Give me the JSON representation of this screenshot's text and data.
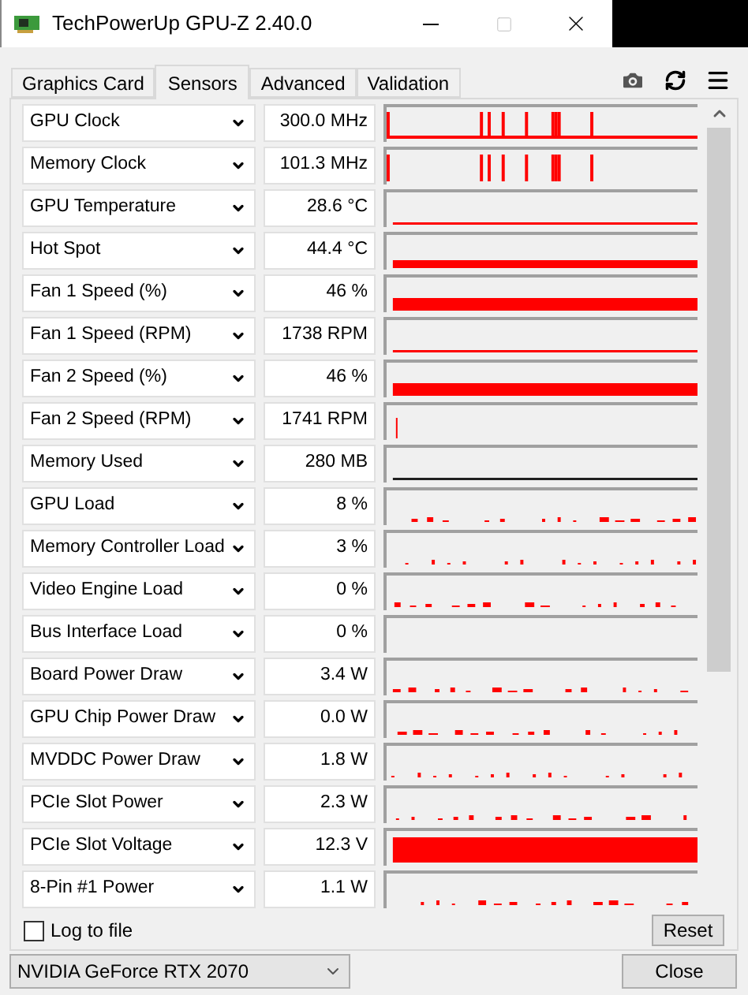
{
  "window": {
    "title": "TechPowerUp GPU-Z 2.40.0"
  },
  "tabs": [
    {
      "label": "Graphics Card",
      "selected": false
    },
    {
      "label": "Sensors",
      "selected": true
    },
    {
      "label": "Advanced",
      "selected": false
    },
    {
      "label": "Validation",
      "selected": false
    }
  ],
  "sensors": [
    {
      "name": "GPU Clock",
      "reading": "300.0 MHz"
    },
    {
      "name": "Memory Clock",
      "reading": "101.3 MHz"
    },
    {
      "name": "GPU Temperature",
      "reading": "28.6 °C"
    },
    {
      "name": "Hot Spot",
      "reading": "44.4 °C"
    },
    {
      "name": "Fan 1 Speed (%)",
      "reading": "46 %"
    },
    {
      "name": "Fan 1 Speed (RPM)",
      "reading": "1738 RPM"
    },
    {
      "name": "Fan 2 Speed (%)",
      "reading": "46 %"
    },
    {
      "name": "Fan 2 Speed (RPM)",
      "reading": "1741 RPM"
    },
    {
      "name": "Memory Used",
      "reading": "280 MB"
    },
    {
      "name": "GPU Load",
      "reading": "8 %"
    },
    {
      "name": "Memory Controller Load",
      "reading": "3 %"
    },
    {
      "name": "Video Engine Load",
      "reading": "0 %"
    },
    {
      "name": "Bus Interface Load",
      "reading": "0 %"
    },
    {
      "name": "Board Power Draw",
      "reading": "3.4 W"
    },
    {
      "name": "GPU Chip Power Draw",
      "reading": "0.0 W"
    },
    {
      "name": "MVDDC Power Draw",
      "reading": "1.8 W"
    },
    {
      "name": "PCIe Slot Power",
      "reading": "2.3 W"
    },
    {
      "name": "PCIe Slot Voltage",
      "reading": "12.3 V"
    },
    {
      "name": "8-Pin #1 Power",
      "reading": "1.1 W"
    }
  ],
  "log_to_file": {
    "label": "Log to file",
    "checked": false
  },
  "reset_button": "Reset",
  "gpu_select": {
    "value": "NVIDIA GeForce RTX 2070"
  },
  "close_button": "Close"
}
